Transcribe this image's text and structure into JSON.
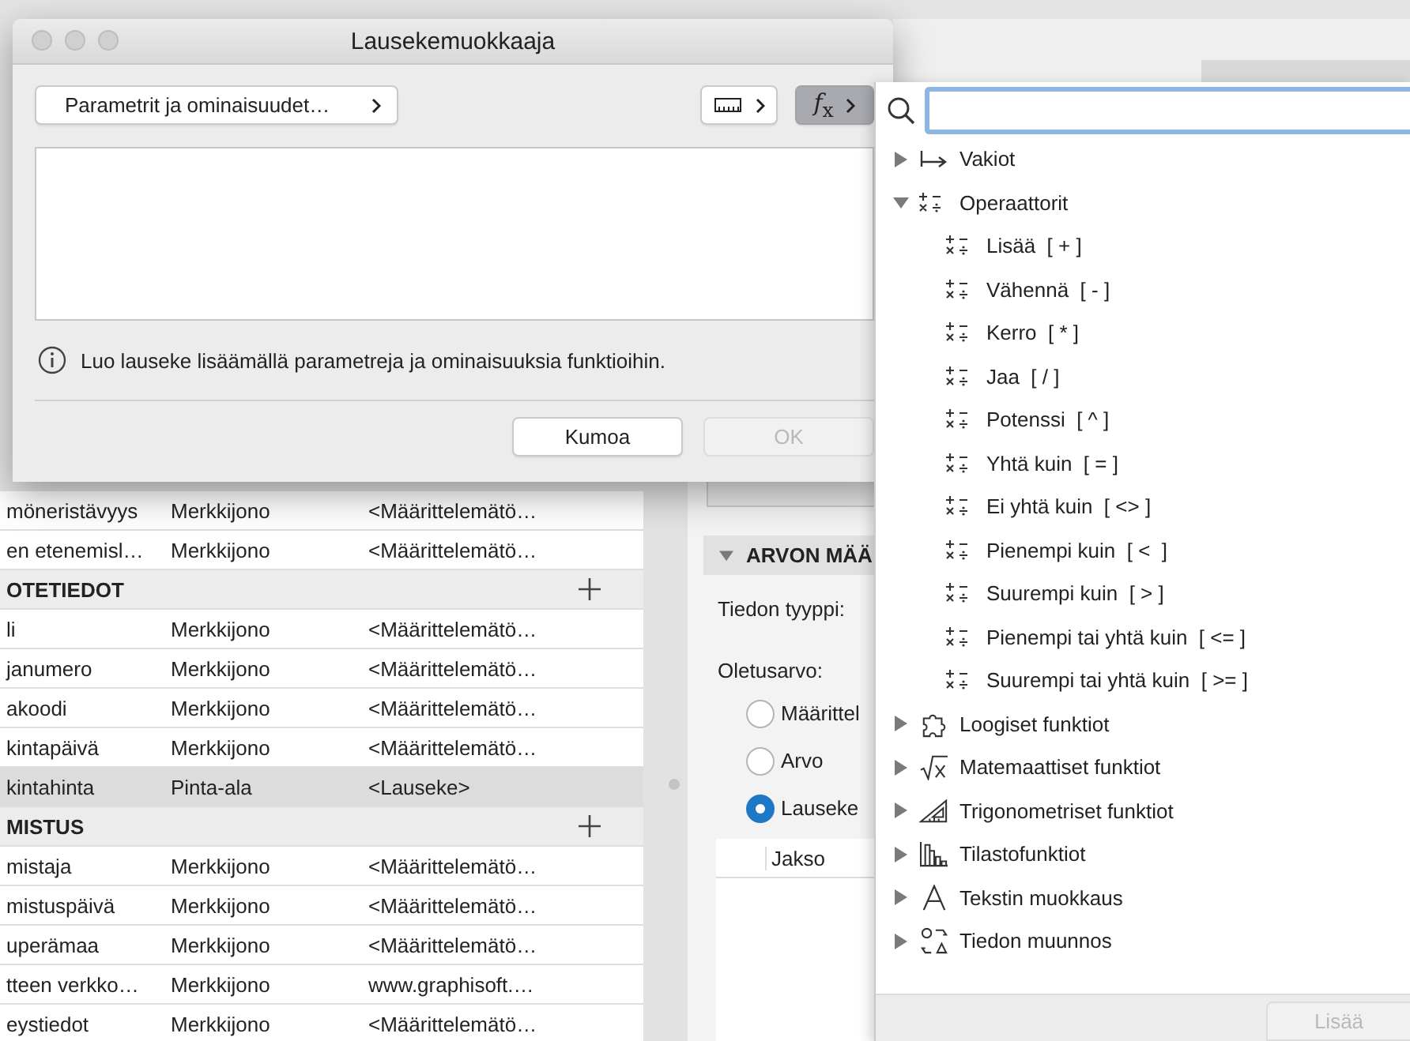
{
  "background": {
    "table": {
      "rows": [
        {
          "kind": "row",
          "name": "möneristävyys",
          "type": "Merkkijono",
          "value": "<Määrittelemätö…",
          "selected": false
        },
        {
          "kind": "row",
          "name": "en etenemisl…",
          "type": "Merkkijono",
          "value": "<Määrittelemätö…",
          "selected": false
        },
        {
          "kind": "heading",
          "name": "OTETIEDOT"
        },
        {
          "kind": "row",
          "name": "li",
          "type": "Merkkijono",
          "value": "<Määrittelemätö…",
          "selected": false
        },
        {
          "kind": "row",
          "name": "janumero",
          "type": "Merkkijono",
          "value": "<Määrittelemätö…",
          "selected": false
        },
        {
          "kind": "row",
          "name": "akoodi",
          "type": "Merkkijono",
          "value": "<Määrittelemätö…",
          "selected": false
        },
        {
          "kind": "row",
          "name": "kintapäivä",
          "type": "Merkkijono",
          "value": "<Määrittelemätö…",
          "selected": false
        },
        {
          "kind": "row",
          "name": "kintahinta",
          "type": "Pinta-ala",
          "value": "<Lauseke>",
          "selected": true
        },
        {
          "kind": "heading",
          "name": "MISTUS"
        },
        {
          "kind": "row",
          "name": "mistaja",
          "type": "Merkkijono",
          "value": "<Määrittelemätö…",
          "selected": false
        },
        {
          "kind": "row",
          "name": "mistuspäivä",
          "type": "Merkkijono",
          "value": "<Määrittelemätö…",
          "selected": false
        },
        {
          "kind": "row",
          "name": "uperämaa",
          "type": "Merkkijono",
          "value": "<Määrittelemätö…",
          "selected": false
        },
        {
          "kind": "row",
          "name": "tteen verkko…",
          "type": "Merkkijono",
          "value": "www.graphisoft.…",
          "selected": false
        },
        {
          "kind": "row",
          "name": "eystiedot",
          "type": "Merkkijono",
          "value": "<Määrittelemätö…",
          "selected": false
        }
      ]
    },
    "panel": {
      "section_title": "ARVON MÄÄ",
      "data_type_label": "Tiedon tyyppi:",
      "default_label": "Oletusarvo:",
      "options": [
        {
          "label": "Määrittel",
          "selected": false
        },
        {
          "label": "Arvo",
          "selected": false
        },
        {
          "label": "Lauseke",
          "selected": true
        }
      ],
      "period_column": "Jakso"
    }
  },
  "dialog": {
    "title": "Lausekemuokkaaja",
    "parameters_button": "Parametrit ja ominaisuudet…",
    "function_button": {
      "label": "*f*$_{x}$",
      "selected": true
    },
    "info": "Luo lauseke lisäämällä parametreja ja ominaisuuksia funktioihin.",
    "buttons": [
      {
        "label": "Kumoa",
        "disabled": false
      },
      {
        "label": "OK",
        "disabled": true
      }
    ]
  },
  "popup": {
    "tree": [
      {
        "kind": "constant",
        "label": "Vakiot",
        "expanded": false
      },
      {
        "kind": "operator",
        "label": "Operaattorit",
        "expanded": true,
        "children": [
          {
            "kind": "operator",
            "label": "Lisää  [ + ]"
          },
          {
            "kind": "operator",
            "label": "Vähennä  [ - ]"
          },
          {
            "kind": "operator",
            "label": "Kerro  [ * ]"
          },
          {
            "kind": "operator",
            "label": "Jaa  [ / ]"
          },
          {
            "kind": "operator",
            "label": "Potenssi  [ ^ ]"
          },
          {
            "kind": "operator",
            "label": "Yhtä kuin  [ = ]"
          },
          {
            "kind": "operator",
            "label": "Ei yhtä kuin  [ <> ]"
          },
          {
            "kind": "operator",
            "label": "Pienempi kuin  [ <  ]"
          },
          {
            "kind": "operator",
            "label": "Suurempi kuin  [ > ]"
          },
          {
            "kind": "operator",
            "label": "Pienempi tai yhtä kuin  [ <= ]"
          },
          {
            "kind": "operator",
            "label": "Suurempi tai yhtä kuin  [ >= ]"
          }
        ]
      },
      {
        "kind": "logic",
        "label": "Loogiset funktiot",
        "expanded": false
      },
      {
        "kind": "math",
        "label": "Matemaattiset funktiot",
        "expanded": false
      },
      {
        "kind": "trig",
        "label": "Trigonometriset funktiot",
        "expanded": false
      },
      {
        "kind": "stats",
        "label": "Tilastofunktiot",
        "expanded": false
      },
      {
        "kind": "text",
        "label": "Tekstin muokkaus",
        "expanded": false
      },
      {
        "kind": "convert",
        "label": "Tiedon muunnos",
        "expanded": false
      }
    ],
    "add_button": {
      "label": "Lisää",
      "disabled": true
    }
  }
}
